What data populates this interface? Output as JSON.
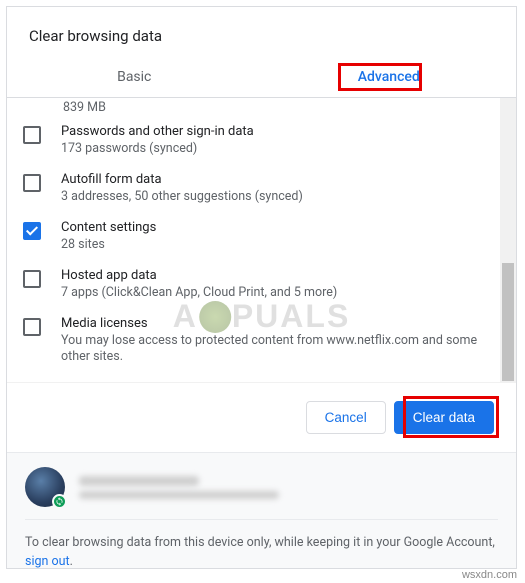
{
  "dialog": {
    "title": "Clear browsing data"
  },
  "tabs": {
    "basic": "Basic",
    "advanced": "Advanced"
  },
  "truncated_top": "839 MB",
  "items": [
    {
      "checked": false,
      "title": "Passwords and other sign-in data",
      "sub": "173 passwords (synced)"
    },
    {
      "checked": false,
      "title": "Autofill form data",
      "sub": "3 addresses, 50 other suggestions (synced)"
    },
    {
      "checked": true,
      "title": "Content settings",
      "sub": "28 sites"
    },
    {
      "checked": false,
      "title": "Hosted app data",
      "sub": "7 apps (Click&Clean App, Cloud Print, and 5 more)"
    },
    {
      "checked": false,
      "title": "Media licenses",
      "sub": "You may lose access to protected content from www.netflix.com and some other sites."
    }
  ],
  "buttons": {
    "cancel": "Cancel",
    "clear": "Clear data"
  },
  "footer": {
    "text_before": "To clear browsing data from this device only, while keeping it in your Google Account, ",
    "link": "sign out",
    "text_after": "."
  },
  "watermark": {
    "left": "A",
    "right": "PUALS"
  },
  "credit": "wsxdn.com"
}
